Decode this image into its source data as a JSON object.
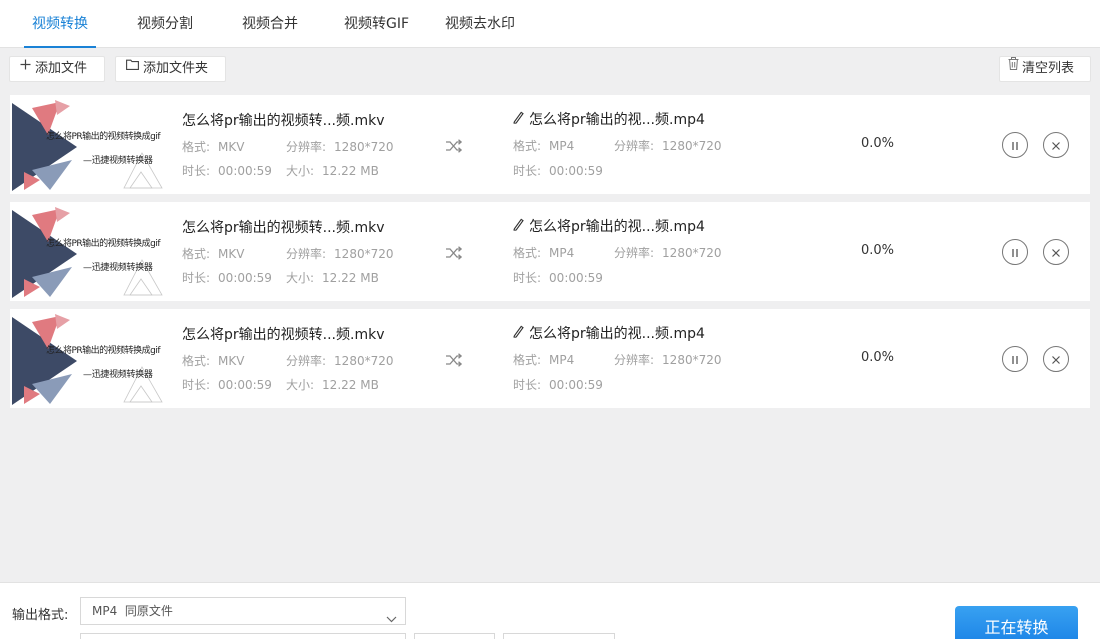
{
  "tabs": [
    {
      "label": "视频转换",
      "active": true
    },
    {
      "label": "视频分割",
      "active": false
    },
    {
      "label": "视频合并",
      "active": false
    },
    {
      "label": "视频转GIF",
      "active": false
    },
    {
      "label": "视频去水印",
      "active": false
    }
  ],
  "toolbar": {
    "add_file": "添加文件",
    "add_folder": "添加文件夹",
    "clear_list": "清空列表"
  },
  "labels": {
    "format": "格式:",
    "resolution": "分辨率:",
    "duration": "时长:",
    "size": "大小:"
  },
  "thumb": {
    "line1": "怎么将PR输出的视频转换成gif",
    "line2": "—迅捷视频转换器"
  },
  "files": [
    {
      "source": {
        "name": "怎么将pr输出的视频转...频.mkv",
        "format": "MKV",
        "resolution": "1280*720",
        "duration": "00:00:59",
        "size": "12.22 MB"
      },
      "output": {
        "name": "怎么将pr输出的视...频.mp4",
        "format": "MP4",
        "resolution": "1280*720",
        "duration": "00:00:59"
      },
      "progress": "0.0%"
    },
    {
      "source": {
        "name": "怎么将pr输出的视频转...频.mkv",
        "format": "MKV",
        "resolution": "1280*720",
        "duration": "00:00:59",
        "size": "12.22 MB"
      },
      "output": {
        "name": "怎么将pr输出的视...频.mp4",
        "format": "MP4",
        "resolution": "1280*720",
        "duration": "00:00:59"
      },
      "progress": "0.0%"
    },
    {
      "source": {
        "name": "怎么将pr输出的视频转...频.mkv",
        "format": "MKV",
        "resolution": "1280*720",
        "duration": "00:00:59",
        "size": "12.22 MB"
      },
      "output": {
        "name": "怎么将pr输出的视...频.mp4",
        "format": "MP4",
        "resolution": "1280*720",
        "duration": "00:00:59"
      },
      "progress": "0.0%"
    }
  ],
  "bottom": {
    "output_format_label": "输出格式:",
    "output_format_value": "MP4  同原文件",
    "convert_label": "正在转换"
  },
  "colors": {
    "accent": "#1a82d6",
    "thumb_dark": "#3d4a66",
    "thumb_pink": "#e07a80",
    "thumb_blue": "#8a9bb8"
  }
}
